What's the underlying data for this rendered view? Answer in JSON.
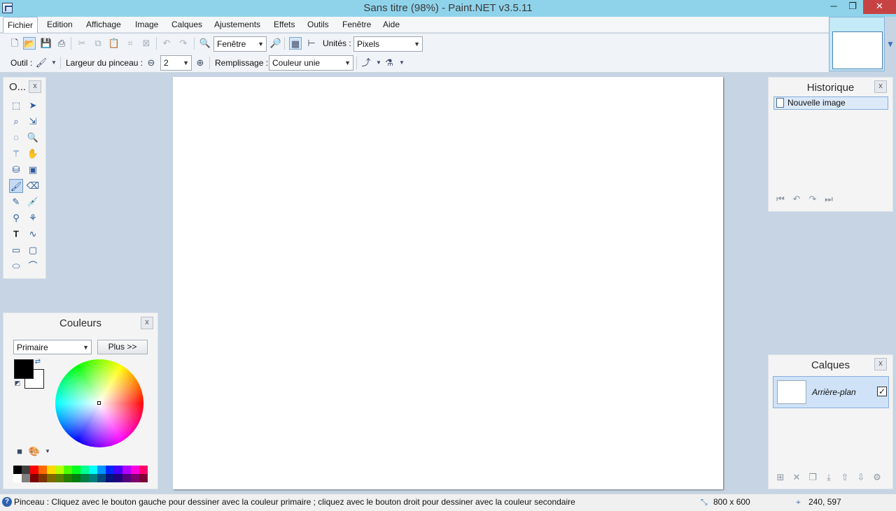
{
  "window": {
    "title": "Sans titre (98%) - Paint.NET v3.5.11",
    "minimize_glyph": "─",
    "maximize_glyph": "❐",
    "close_glyph": "✕"
  },
  "menu": [
    {
      "label": "Fichier"
    },
    {
      "label": "Edition"
    },
    {
      "label": "Affichage"
    },
    {
      "label": "Image"
    },
    {
      "label": "Calques"
    },
    {
      "label": "Ajustements"
    },
    {
      "label": "Effets"
    },
    {
      "label": "Outils"
    },
    {
      "label": "Fenêtre"
    },
    {
      "label": "Aide"
    }
  ],
  "toolbar": {
    "zoom_value": "Fenêtre",
    "units_label": "Unités :",
    "units_value": "Pixels",
    "tool_label": "Outil :",
    "brush_width_label": "Largeur du pinceau :",
    "brush_width_value": "2",
    "fill_label": "Remplissage :",
    "fill_value": "Couleur unie",
    "icons": {
      "new": "new-document-icon",
      "open": "open-folder-icon",
      "save": "save-icon",
      "print": "print-icon",
      "cut": "cut-icon",
      "copy": "copy-icon",
      "paste": "paste-icon",
      "crop": "crop-icon",
      "deselect": "deselect-icon",
      "undo": "undo-icon",
      "redo": "redo-icon",
      "zoom_out": "zoom-out-icon",
      "zoom_in": "zoom-in-icon",
      "grid": "grid-icon",
      "rulers": "rulers-icon"
    }
  },
  "tools_panel": {
    "title": "O...",
    "close": "x",
    "selected": "paintbrush"
  },
  "colors_panel": {
    "title": "Couleurs",
    "close": "x",
    "mode_value": "Primaire",
    "more_button": "Plus >>",
    "primary_color": "#000000",
    "secondary_color": "#ffffff",
    "palette_top": [
      "#000000",
      "#404040",
      "#ff0000",
      "#ff6a00",
      "#ffd800",
      "#b6ff00",
      "#4cff00",
      "#00ff21",
      "#00ff90",
      "#00ffff",
      "#0094ff",
      "#0026ff",
      "#4800ff",
      "#b200ff",
      "#ff00dc",
      "#ff006e"
    ],
    "palette_bottom": [
      "#ffffff",
      "#808080",
      "#7f0000",
      "#7f3300",
      "#7f6a00",
      "#5b7f00",
      "#267f00",
      "#007f0e",
      "#007f46",
      "#007f7f",
      "#004a7f",
      "#00137f",
      "#21007f",
      "#57007f",
      "#7f006e",
      "#7f0037"
    ]
  },
  "history_panel": {
    "title": "Historique",
    "close": "x",
    "items": [
      {
        "label": "Nouvelle image"
      }
    ]
  },
  "layers_panel": {
    "title": "Calques",
    "close": "x",
    "layers": [
      {
        "name": "Arrière-plan",
        "visible": true
      }
    ]
  },
  "status": {
    "message": "Pinceau : Cliquez avec le bouton gauche pour dessiner avec la couleur primaire ; cliquez avec le bouton droit pour dessiner avec la couleur secondaire",
    "image_size": "800 x 600",
    "cursor_position": "240, 597"
  },
  "colors": {
    "title_bar": "#8fd3eb",
    "workspace": "#c6d4e3",
    "selection": "#cfe2f7"
  }
}
